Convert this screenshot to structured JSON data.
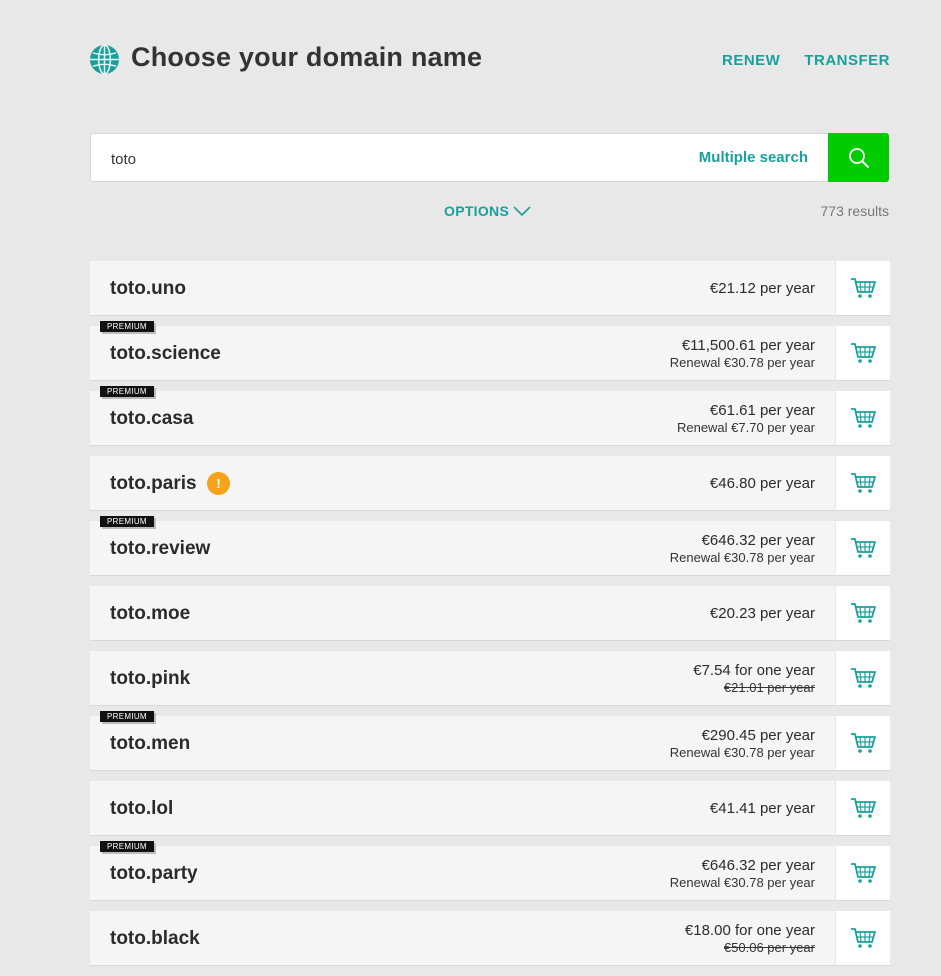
{
  "header": {
    "title": "Choose your domain name",
    "renew_label": "RENEW",
    "transfer_label": "TRANSFER"
  },
  "search": {
    "value": "toto",
    "multiple_search_label": "Multiple search"
  },
  "options_label": "OPTIONS",
  "results_count": "773 results",
  "colors": {
    "accent": "#1aa09c",
    "search_button": "#00cc00",
    "warning": "#f6a21b"
  },
  "results": [
    {
      "domain": "toto.uno",
      "badge": "",
      "price": "€21.12 per year",
      "sub": "",
      "sub_strike": false,
      "warning": false
    },
    {
      "domain": "toto.science",
      "badge": "PREMIUM",
      "price": "€11,500.61 per year",
      "sub": "Renewal €30.78 per year",
      "sub_strike": false,
      "warning": false
    },
    {
      "domain": "toto.casa",
      "badge": "PREMIUM",
      "price": "€61.61 per year",
      "sub": "Renewal €7.70 per year",
      "sub_strike": false,
      "warning": false
    },
    {
      "domain": "toto.paris",
      "badge": "",
      "price": "€46.80 per year",
      "sub": "",
      "sub_strike": false,
      "warning": true,
      "warning_symbol": "!"
    },
    {
      "domain": "toto.review",
      "badge": "PREMIUM",
      "price": "€646.32 per year",
      "sub": "Renewal €30.78 per year",
      "sub_strike": false,
      "warning": false
    },
    {
      "domain": "toto.moe",
      "badge": "",
      "price": "€20.23 per year",
      "sub": "",
      "sub_strike": false,
      "warning": false
    },
    {
      "domain": "toto.pink",
      "badge": "",
      "price": "€7.54 for one year",
      "sub": "€21.01 per year",
      "sub_strike": true,
      "warning": false
    },
    {
      "domain": "toto.men",
      "badge": "PREMIUM",
      "price": "€290.45 per year",
      "sub": "Renewal €30.78 per year",
      "sub_strike": false,
      "warning": false
    },
    {
      "domain": "toto.lol",
      "badge": "",
      "price": "€41.41 per year",
      "sub": "",
      "sub_strike": false,
      "warning": false
    },
    {
      "domain": "toto.party",
      "badge": "PREMIUM",
      "price": "€646.32 per year",
      "sub": "Renewal €30.78 per year",
      "sub_strike": false,
      "warning": false
    },
    {
      "domain": "toto.black",
      "badge": "",
      "price": "€18.00 for one year",
      "sub": "€50.06 per year",
      "sub_strike": true,
      "warning": false
    }
  ]
}
